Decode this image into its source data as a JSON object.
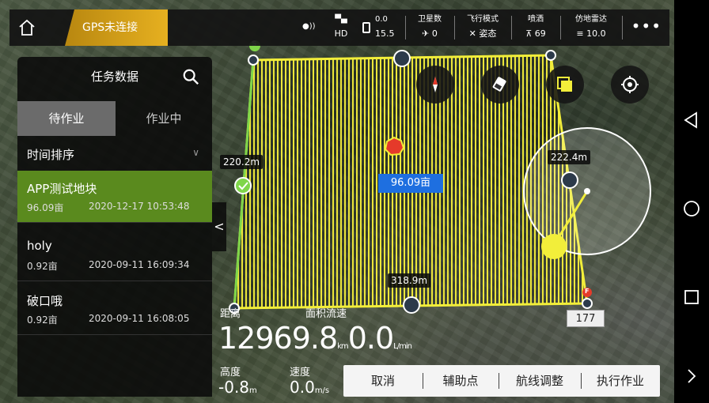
{
  "topbar": {
    "gps_status": "GPS未连接",
    "signal_label": "HD",
    "battery_top": "0.0",
    "battery_bottom": "15.5",
    "satellites_label": "卫星数",
    "satellites_value": "0",
    "flight_mode_label": "飞行模式",
    "flight_mode_value": "姿态",
    "spray_label": "喷洒",
    "spray_value": "69",
    "radar_label": "仿地雷达",
    "radar_value": "10.0",
    "more": "•••"
  },
  "panel": {
    "title": "任务数据",
    "tab_pending": "待作业",
    "tab_working": "作业中",
    "sort_label": "时间排序",
    "tasks": [
      {
        "name": "APP测试地块",
        "area": "96.09亩",
        "date": "2020-12-17 10:53:48"
      },
      {
        "name": "holy",
        "area": "0.92亩",
        "date": "2020-09-11 16:09:34"
      },
      {
        "name": "破口哦",
        "area": "0.92亩",
        "date": "2020-09-11 16:08:05"
      }
    ]
  },
  "map": {
    "edge_left": "220.2m",
    "edge_right": "222.4m",
    "edge_bottom": "318.9m",
    "area": "96.09亩",
    "point_id": "177",
    "start_marker": "S",
    "end_marker": "F"
  },
  "telemetry": {
    "distance_label": "距离",
    "area_flow_label": "面积流速",
    "distance_value": "12969.8",
    "distance_unit": "km",
    "flow_value": "0.0",
    "flow_unit": "L/min",
    "height_label": "高度",
    "height_value": "-0.8",
    "height_unit": "m",
    "speed_label": "速度",
    "speed_value": "0.0",
    "speed_unit": "m/s"
  },
  "actions": {
    "cancel": "取消",
    "aux_point": "辅助点",
    "route_adjust": "航线调整",
    "execute": "执行作业"
  },
  "colors": {
    "accent_yellow": "#e6e02a",
    "gps_pill": "#d9a21a",
    "active_task": "#5a8a1e",
    "area_badge": "#1e6fe0"
  }
}
